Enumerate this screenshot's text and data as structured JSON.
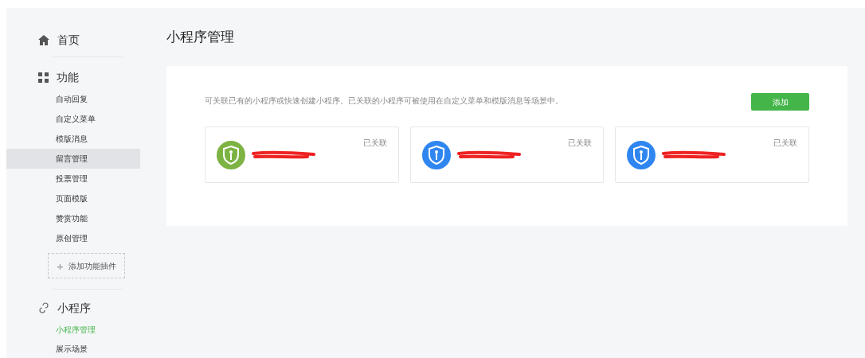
{
  "sidebar": {
    "sections": [
      {
        "kind": "home",
        "title": "首页"
      },
      {
        "kind": "grid",
        "title": "功能",
        "items": [
          {
            "label": "自动回复",
            "selected": false,
            "hovered": false
          },
          {
            "label": "自定义菜单",
            "selected": false,
            "hovered": false
          },
          {
            "label": "模版消息",
            "selected": false,
            "hovered": false
          },
          {
            "label": "留言管理",
            "selected": false,
            "hovered": true
          },
          {
            "label": "投票管理",
            "selected": false,
            "hovered": false
          },
          {
            "label": "页面模版",
            "selected": false,
            "hovered": false
          },
          {
            "label": "赞赏功能",
            "selected": false,
            "hovered": false
          },
          {
            "label": "原创管理",
            "selected": false,
            "hovered": false
          }
        ],
        "add_plugin": {
          "icon": "+",
          "label": "添加功能插件"
        }
      },
      {
        "kind": "link",
        "title": "小程序",
        "items": [
          {
            "label": "小程序管理",
            "selected": true,
            "hovered": false
          },
          {
            "label": "展示场景",
            "selected": false,
            "hovered": false
          }
        ]
      }
    ]
  },
  "page_title": "小程序管理",
  "panel": {
    "description": "可关联已有的小程序或快速创建小程序。已关联的小程序可被使用在自定义菜单和模版消息等场景中。",
    "add_button": "添加",
    "cards": [
      {
        "status": "已关联",
        "color": "#7cb342"
      },
      {
        "status": "已关联",
        "color": "#2f86f0"
      },
      {
        "status": "已关联",
        "color": "#2f86f0"
      }
    ]
  }
}
